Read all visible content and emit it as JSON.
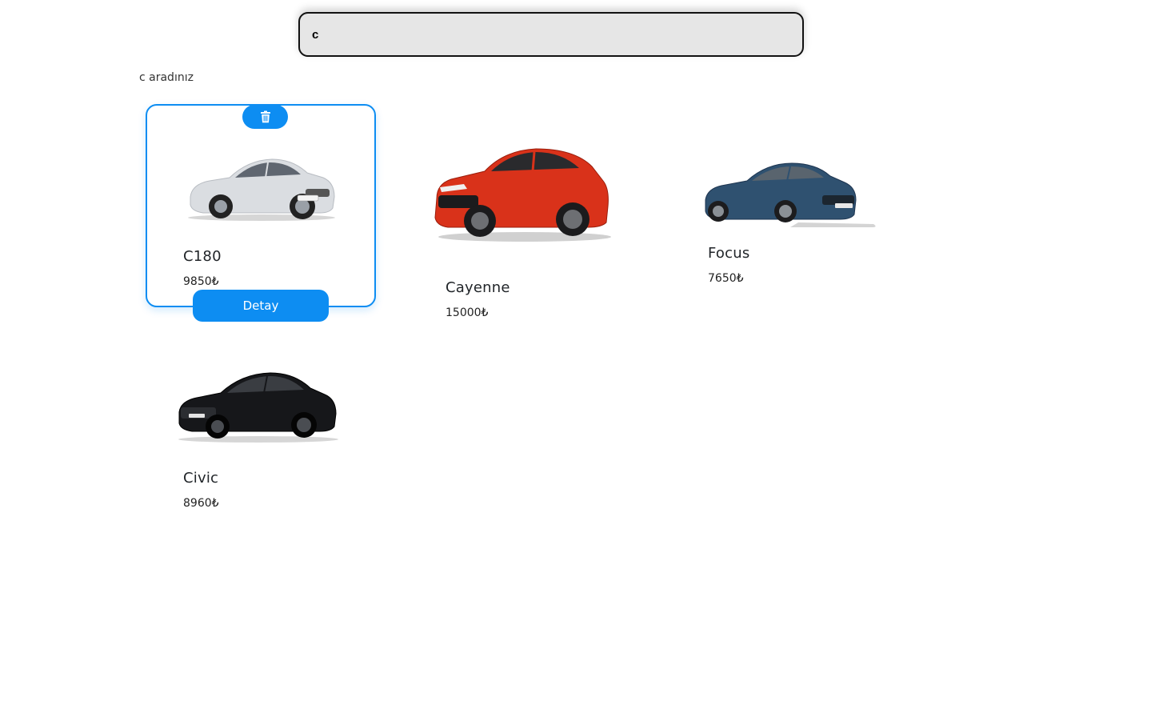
{
  "search": {
    "value": "c"
  },
  "result_text": "c aradınız",
  "cars": [
    {
      "name": "C180",
      "price": "9850₺",
      "color": "#d9dce0",
      "type": "coupe"
    },
    {
      "name": "Cayenne",
      "price": "15000₺",
      "color": "#d9321a",
      "type": "suv"
    },
    {
      "name": "Focus",
      "price": "7650₺",
      "color": "#2f5170",
      "type": "sedan"
    },
    {
      "name": "Civic",
      "price": "8960₺",
      "color": "#16171a",
      "type": "sedan"
    }
  ],
  "card_actions": {
    "delete_icon": "trash-icon",
    "detail_label": "Detay"
  },
  "colors": {
    "accent": "#0d8df2"
  }
}
